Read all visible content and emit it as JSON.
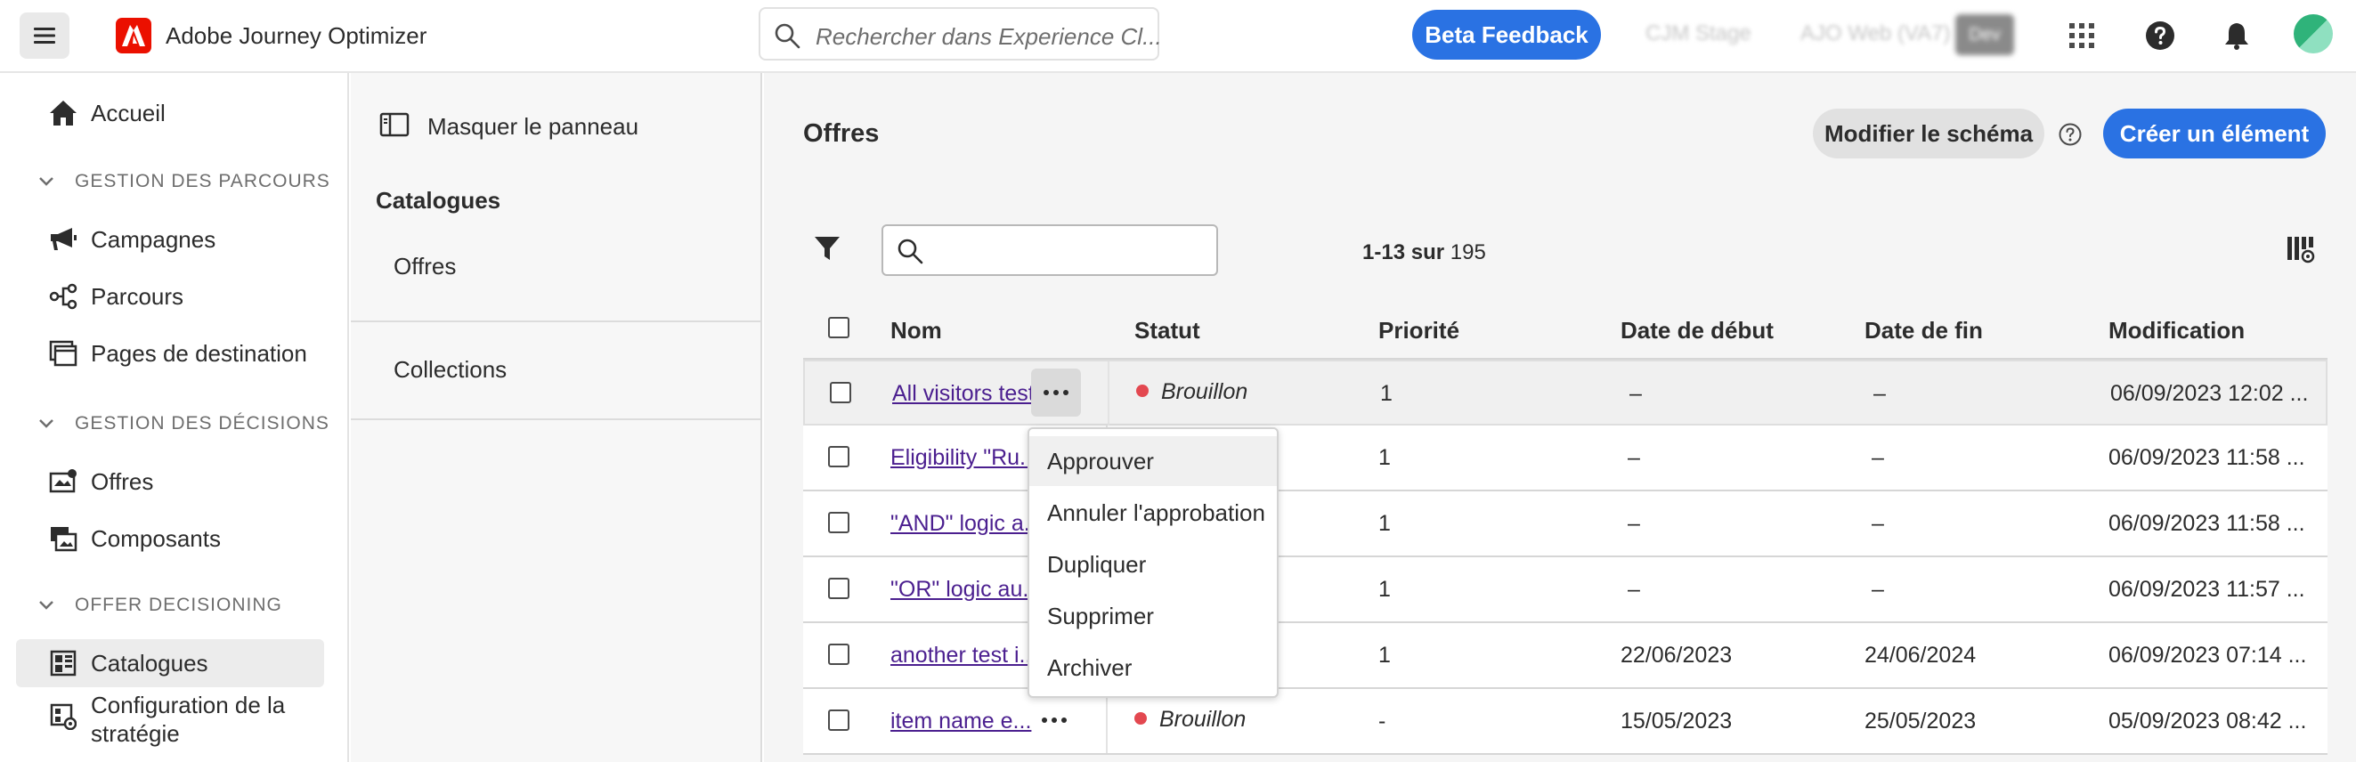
{
  "topbar": {
    "app_title": "Adobe Journey Optimizer",
    "search_placeholder": "Rechercher dans Experience Cl...",
    "beta_feedback_label": "Beta Feedback",
    "org_label": "CJM Stage",
    "sandbox_label": "AJO Web (VA7)",
    "env_badge": "Dev"
  },
  "leftnav": {
    "home": "Accueil",
    "sections": [
      {
        "title": "GESTION DES PARCOURS",
        "items": [
          "Campagnes",
          "Parcours",
          "Pages de destination"
        ]
      },
      {
        "title": "GESTION DES DÉCISIONS",
        "items": [
          "Offres",
          "Composants"
        ]
      },
      {
        "title": "OFFER DECISIONING",
        "items": [
          "Catalogues",
          "Configuration de la stratégie"
        ]
      }
    ]
  },
  "midpanel": {
    "hide_label": "Masquer le panneau",
    "heading": "Catalogues",
    "items": [
      "Offres",
      "Collections"
    ]
  },
  "content": {
    "title": "Offres",
    "edit_schema_label": "Modifier le schéma",
    "create_label": "Créer un élément",
    "count_range": "1-13",
    "count_sep": "sur",
    "count_total": "195",
    "columns": [
      "Nom",
      "Statut",
      "Priorité",
      "Date de début",
      "Date de fin",
      "Modification"
    ],
    "rows": [
      {
        "name": "All visitors test",
        "status": "Brouillon",
        "priority": "1",
        "start": "–",
        "end": "–",
        "modified": "06/09/2023 12:02 ..."
      },
      {
        "name": "Eligibility \"Ru...",
        "status": "",
        "priority": "1",
        "start": "–",
        "end": "–",
        "modified": "06/09/2023 11:58 ..."
      },
      {
        "name": "\"AND\" logic a...",
        "status": "",
        "priority": "1",
        "start": "–",
        "end": "–",
        "modified": "06/09/2023 11:58 ..."
      },
      {
        "name": "\"OR\" logic au...",
        "status": "",
        "priority": "1",
        "start": "–",
        "end": "–",
        "modified": "06/09/2023 11:57 ..."
      },
      {
        "name": "another test i...",
        "status": "",
        "priority": "1",
        "start": "22/06/2023",
        "end": "24/06/2024",
        "modified": "06/09/2023 07:14 ..."
      },
      {
        "name": "item name e...",
        "status": "Brouillon",
        "priority": "-",
        "start": "15/05/2023",
        "end": "25/05/2023",
        "modified": "05/09/2023 08:42 ..."
      }
    ],
    "context_menu": [
      "Approuver",
      "Annuler l'approbation",
      "Dupliquer",
      "Supprimer",
      "Archiver"
    ]
  },
  "colors": {
    "accent": "#2a72e3",
    "adobe_red": "#eb1000",
    "draft_dot": "#e34850",
    "link": "#4b1f8f"
  }
}
